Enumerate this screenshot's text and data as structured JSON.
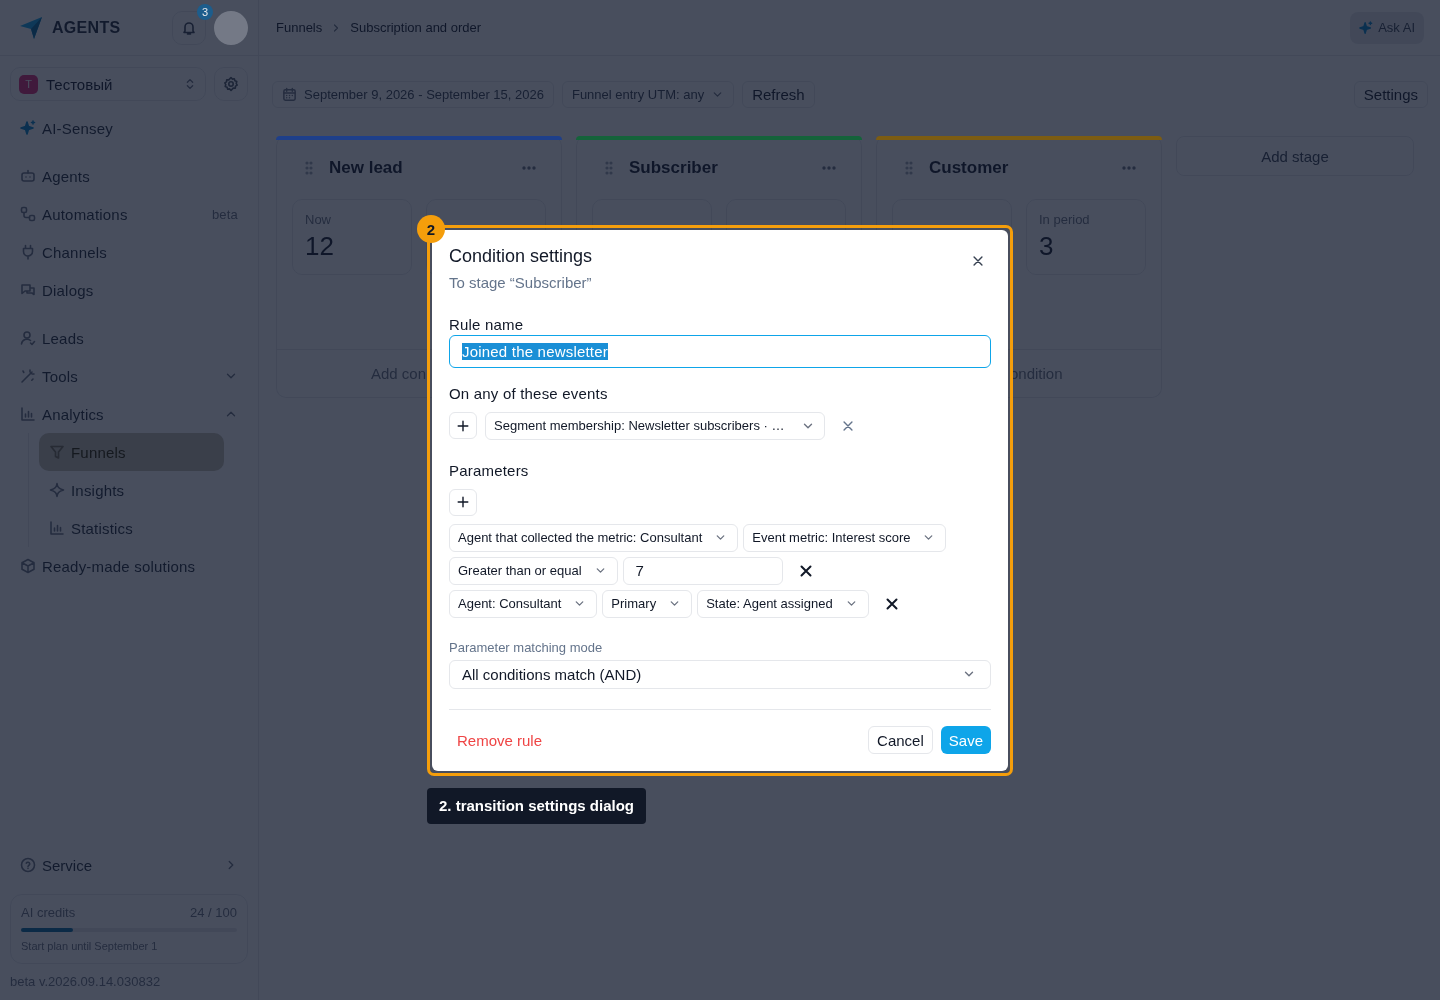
{
  "sidebar": {
    "logo": "AGENTS",
    "notifications_count": "3",
    "workspace": {
      "initial": "T",
      "name": "Тестовый"
    },
    "nav_groups": [
      {
        "items": [
          {
            "label": "AI-Sensey",
            "selected": false
          }
        ]
      },
      {
        "items": [
          {
            "label": "Agents",
            "selected": false
          },
          {
            "label": "Automations",
            "badge": "beta",
            "selected": false
          },
          {
            "label": "Channels",
            "selected": false
          },
          {
            "label": "Dialogs",
            "selected": false
          }
        ]
      },
      {
        "items": [
          {
            "label": "Leads",
            "selected": false
          },
          {
            "label": "Tools",
            "selected": false,
            "expanded": false
          },
          {
            "label": "Analytics",
            "selected": false,
            "expanded": true,
            "children": [
              {
                "label": "Funnels",
                "selected": true
              },
              {
                "label": "Insights",
                "selected": false
              },
              {
                "label": "Statistics",
                "selected": false
              }
            ]
          },
          {
            "label": "Ready-made solutions",
            "selected": false
          }
        ]
      }
    ],
    "service": "Service",
    "credits": {
      "label": "AI credits",
      "count": "24 / 100",
      "level": 0.24,
      "plan": "Start plan until September 1"
    },
    "version": "beta v.2026.09.14.030832"
  },
  "header": {
    "breadcrumbs": [
      "Funnels",
      "Subscription and order"
    ],
    "ask_ai": "Ask AI"
  },
  "toolbar": {
    "date_range": "September 9, 2026 - September 15, 2026",
    "utm_filter": "Funnel entry UTM: any",
    "refresh": "Refresh",
    "settings": "Settings"
  },
  "stages": [
    {
      "title": "New lead",
      "color": "#1e3f8a",
      "now": {
        "label": "Now",
        "value": "12"
      },
      "footer": "Add con"
    },
    {
      "title": "Subscriber",
      "color": "#14633a"
    },
    {
      "title": "Customer",
      "color": "#7c5c12",
      "in_period": {
        "label": "In period",
        "value": "3"
      },
      "footer": "ondition"
    }
  ],
  "add_stage": "Add stage",
  "dialog": {
    "title": "Condition settings",
    "subtitle": "To stage “Subscriber”",
    "rule_label": "Rule name",
    "rule_value": "Joined the newsletter",
    "rule_value_selected": true,
    "events_label": "On any of these events",
    "events": [
      {
        "text": "Segment membership: Newsletter subscribers · …"
      }
    ],
    "parameters_label": "Parameters",
    "parameters": [
      {
        "lines": [
          [
            {
              "kind": "select",
              "text": "Agent that collected the metric: Consultant"
            },
            {
              "kind": "select",
              "text": "Event metric: Interest score"
            }
          ],
          [
            {
              "kind": "select",
              "text": "Greater than or equal"
            },
            {
              "kind": "value",
              "text": "7"
            }
          ]
        ]
      },
      {
        "lines": [
          [
            {
              "kind": "select",
              "text": "Agent: Consultant"
            },
            {
              "kind": "select",
              "text": "Primary"
            },
            {
              "kind": "select",
              "text": "State: Agent assigned"
            }
          ]
        ]
      }
    ],
    "matching_label": "Parameter matching mode",
    "matching_value": "All conditions match (AND)",
    "remove": "Remove rule",
    "cancel": "Cancel",
    "save": "Save"
  },
  "annotation": {
    "number": "2",
    "label": "2. transition settings dialog"
  }
}
